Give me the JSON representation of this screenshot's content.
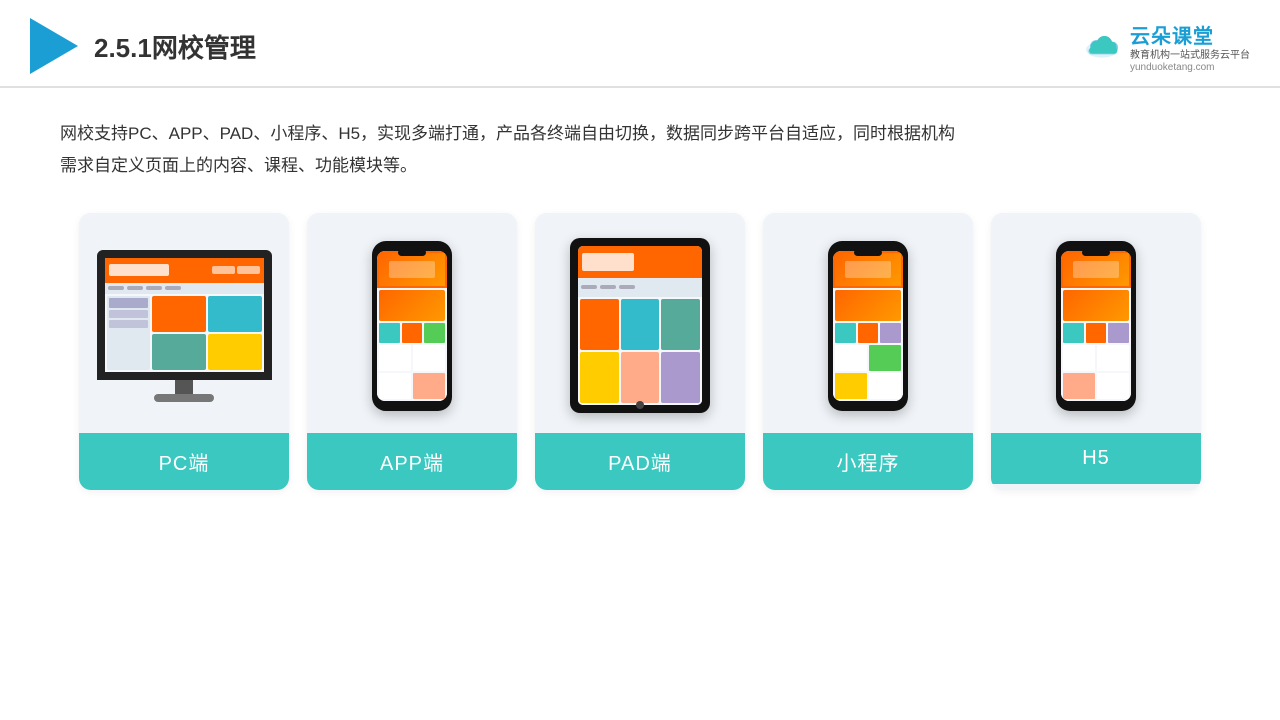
{
  "header": {
    "title": "2.5.1网校管理",
    "brand_name": "云朵课堂",
    "brand_tagline_line1": "教育机构一站",
    "brand_tagline_line2": "式服务云平台",
    "brand_url": "yunduoketang.com"
  },
  "description": {
    "text": "网校支持PC、APP、PAD、小程序、H5，实现多端打通，产品各终端自由切换，数据同步跨平台自适应，同时根据机构需求自定义页面上的内容、课程、功能模块等。"
  },
  "cards": [
    {
      "id": "pc",
      "label": "PC端",
      "type": "monitor"
    },
    {
      "id": "app",
      "label": "APP端",
      "type": "phone"
    },
    {
      "id": "pad",
      "label": "PAD端",
      "type": "tablet"
    },
    {
      "id": "miniapp",
      "label": "小程序",
      "type": "phone"
    },
    {
      "id": "h5",
      "label": "H5",
      "type": "phone"
    }
  ]
}
